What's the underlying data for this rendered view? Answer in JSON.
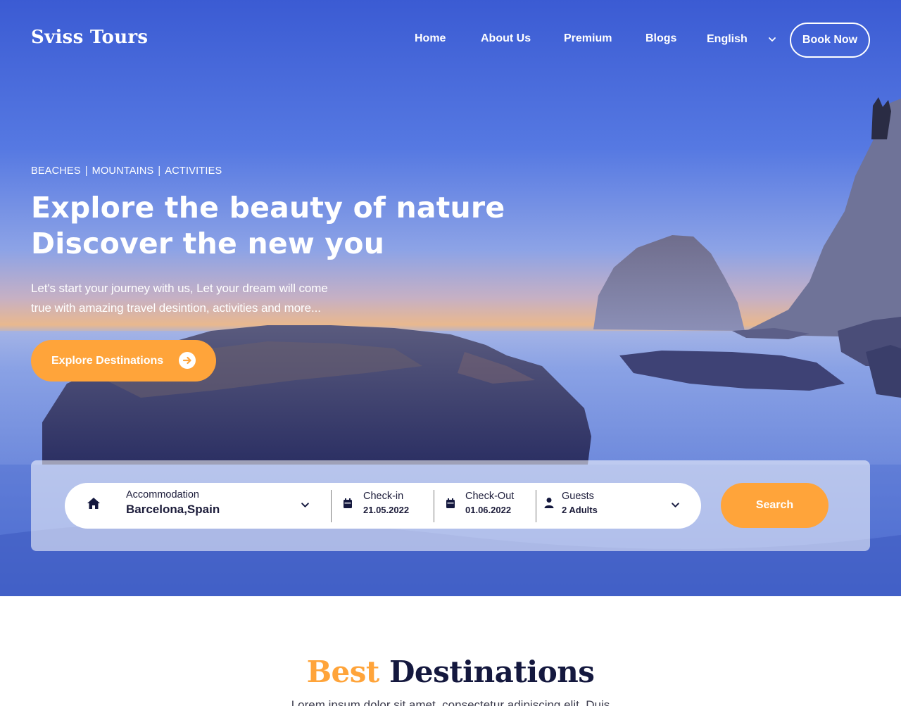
{
  "brand": {
    "name": "Sviss Tours"
  },
  "nav": {
    "items": [
      {
        "label": "Home"
      },
      {
        "label": "About Us"
      },
      {
        "label": "Premium"
      },
      {
        "label": "Blogs"
      }
    ],
    "language": "English",
    "book_label": "Book Now"
  },
  "hero": {
    "tags": [
      "BEACHES",
      "MOUNTAINS",
      "ACTIVITIES"
    ],
    "tag_separator": "|",
    "headline_line1": "Explore the beauty of nature",
    "headline_line2": "Discover the new you",
    "lead_line1": "Let's start your journey with us, Let your dream will come",
    "lead_line2": "true with amazing travel desintion, activities and more...",
    "cta_label": "Explore Destinations"
  },
  "search": {
    "accommodation": {
      "label": "Accommodation",
      "value": "Barcelona,Spain"
    },
    "checkin": {
      "label": "Check-in",
      "value": "21.05.2022"
    },
    "checkout": {
      "label": "Check-Out",
      "value": "01.06.2022"
    },
    "guests": {
      "label": "Guests",
      "value": "2 Adults"
    },
    "button_label": "Search"
  },
  "section": {
    "title_accent": "Best",
    "title_rest": "Destinations",
    "subtitle": "Lorem ipsum dolor sit amet, consectetur adipiscing elit. Duis"
  },
  "colors": {
    "accent": "#ffa43a",
    "dark_text": "#14183e",
    "white": "#ffffff"
  },
  "icons": {
    "home": "home-icon",
    "calendar": "calendar-icon",
    "user": "user-icon",
    "chevron": "chevron-down-icon",
    "arrow": "arrow-right-circle-icon"
  }
}
